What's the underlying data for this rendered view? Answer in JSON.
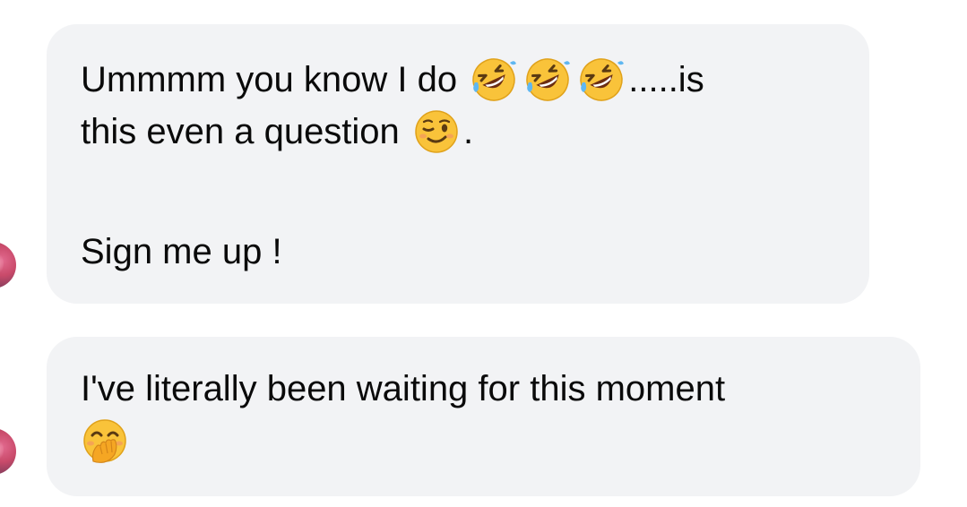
{
  "conversation": {
    "messages": [
      {
        "line1_text": "Ummmm you know I do",
        "line1_emojis": [
          "rolling-on-floor-laughing",
          "rolling-on-floor-laughing",
          "rolling-on-floor-laughing"
        ],
        "line1_suffix": ".....is",
        "line2_text": "this even a question",
        "line2_emoji": "winking-face",
        "line2_suffix": ".",
        "line3_text": "Sign me up !"
      },
      {
        "line1_text": "I've literally been waiting for this moment",
        "line2_emoji": "face-with-hand-over-mouth"
      }
    ]
  },
  "colors": {
    "bubble_background": "#f2f3f5",
    "text": "#0a0a0a",
    "page_background": "#ffffff"
  }
}
